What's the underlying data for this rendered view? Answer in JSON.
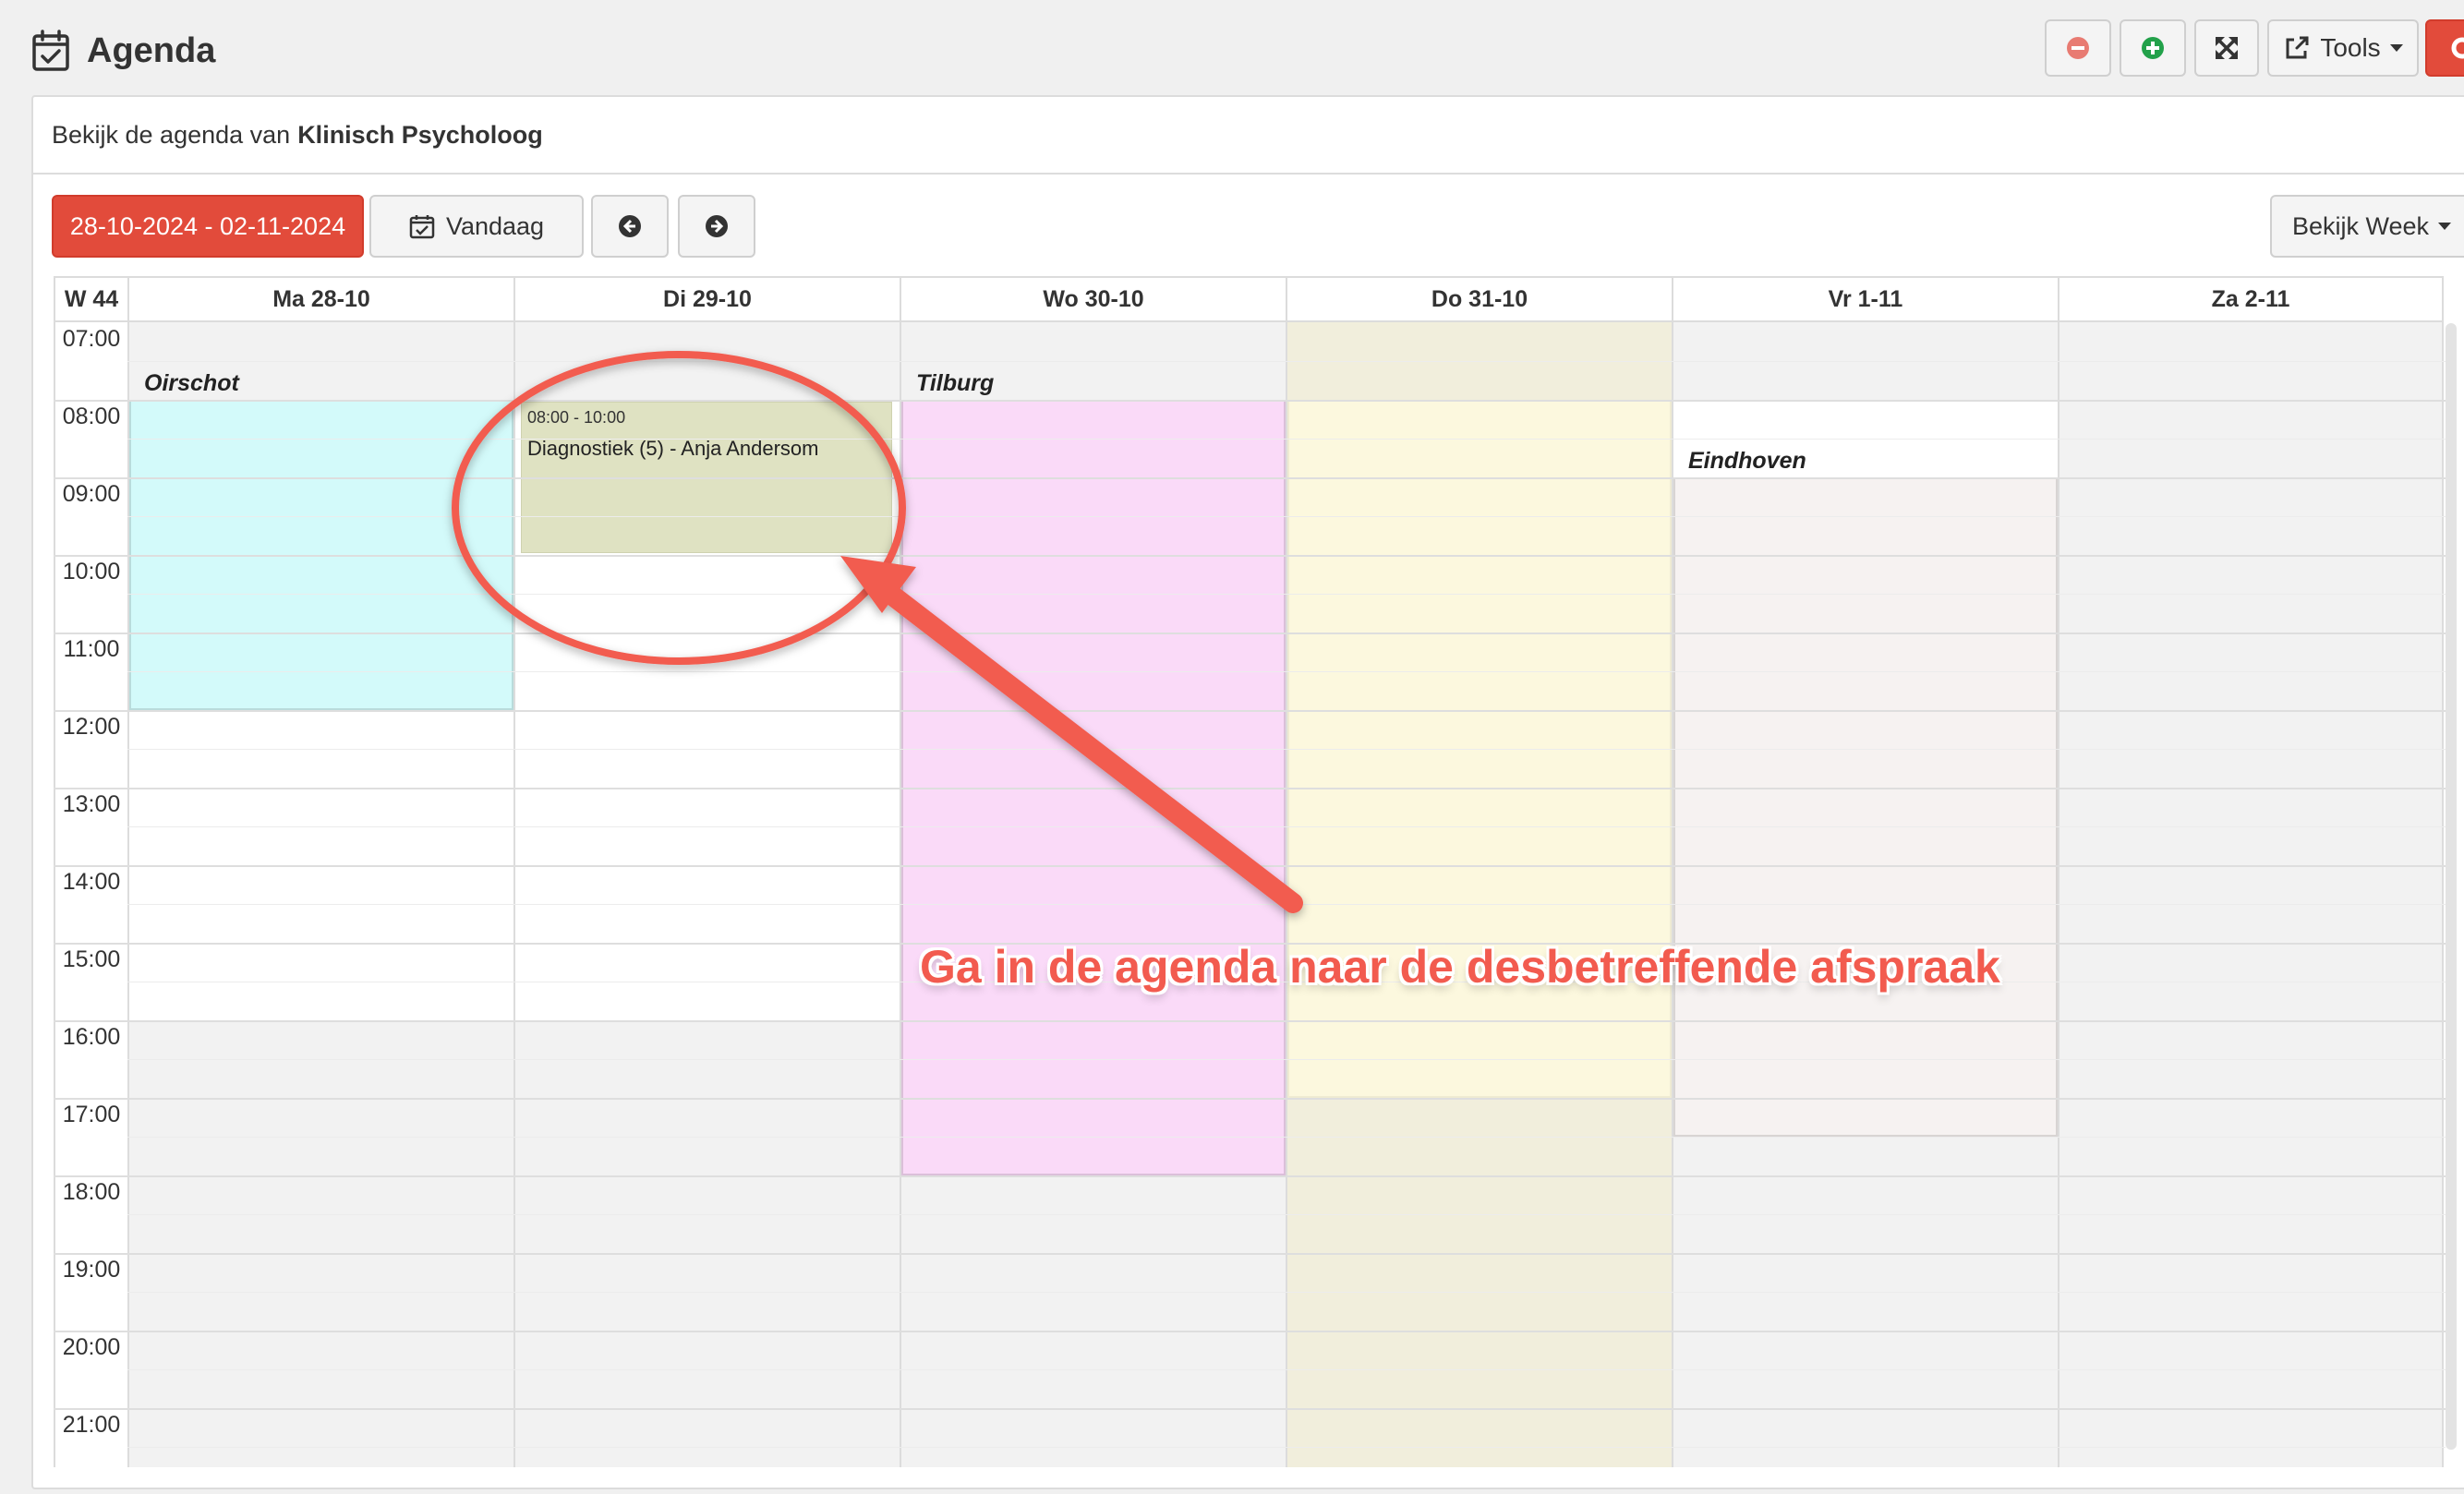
{
  "header": {
    "title": "Agenda",
    "tools_label": "Tools"
  },
  "panel": {
    "subtitle_prefix": "Bekijk de agenda van",
    "subtitle_name": "Klinisch Psycholoog"
  },
  "toolbar": {
    "date_range": "28-10-2024 - 02-11-2024",
    "today_label": "Vandaag",
    "view_label": "Bekijk Week"
  },
  "calendar": {
    "week_label": "W 44",
    "days": [
      {
        "label": "Ma 28-10"
      },
      {
        "label": "Di 29-10"
      },
      {
        "label": "Wo 30-10"
      },
      {
        "label": "Do 31-10"
      },
      {
        "label": "Vr 1-11"
      },
      {
        "label": "Za 2-11"
      }
    ],
    "times": [
      "07:00",
      "08:00",
      "09:00",
      "10:00",
      "11:00",
      "12:00",
      "13:00",
      "14:00",
      "15:00",
      "16:00",
      "17:00",
      "18:00",
      "19:00",
      "20:00",
      "21:00"
    ],
    "locations": {
      "oirschot": "Oirschot",
      "tilburg": "Tilburg",
      "eindhoven": "Eindhoven"
    },
    "event": {
      "time": "08:00 - 10:00",
      "title": "Diagnostiek (5) - Anja Andersom"
    }
  },
  "colors": {
    "primary_red": "#e24b3b",
    "oirschot": "#d3fafa",
    "tilburg": "#fadaf8",
    "thursday": "#fcf8de",
    "eindhoven": "#f6f2f1",
    "event": "#dfe2c2",
    "annotation": "#f25b4f"
  },
  "annotation": {
    "text": "Ga in de agenda naar de desbetreffende afspraak"
  }
}
